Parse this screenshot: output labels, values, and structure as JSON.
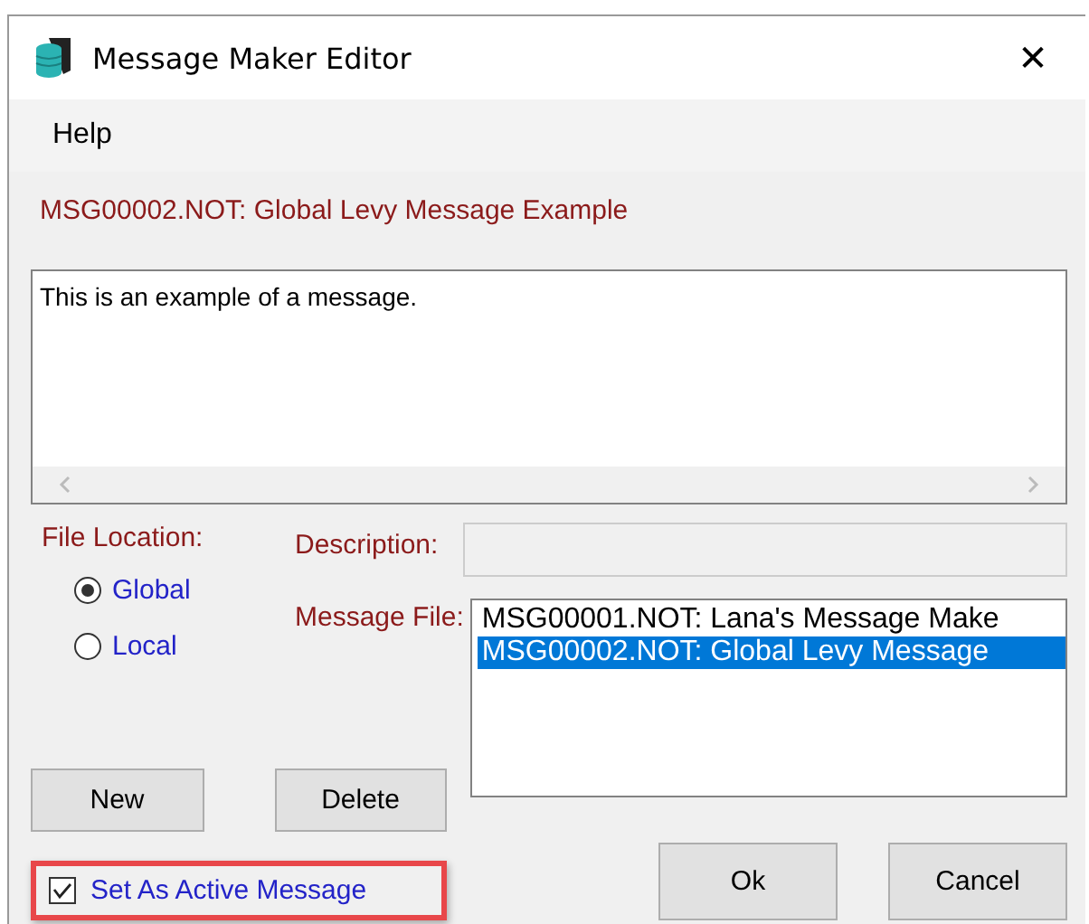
{
  "window": {
    "title": "Message Maker Editor",
    "close": "✕"
  },
  "menu": [
    {
      "label": "Help"
    }
  ],
  "heading": "MSG00002.NOT: Global Levy Message Example",
  "message_text": "This is an example of a message.",
  "file_location": {
    "label": "File Location:",
    "options": [
      {
        "label": "Global",
        "selected": true
      },
      {
        "label": "Local",
        "selected": false
      }
    ]
  },
  "description": {
    "label": "Description:",
    "disabled": true
  },
  "message_file": {
    "label": "Message File:",
    "items": [
      {
        "label": "MSG00001.NOT: Lana's Message Make",
        "selected": false
      },
      {
        "label": "MSG00002.NOT: Global Levy Message",
        "selected": true
      }
    ]
  },
  "buttons_left": [
    "New",
    "Delete"
  ],
  "active_checkbox": {
    "label": "Set As Active Message",
    "checked": true,
    "highlighted": true
  },
  "buttons_right": [
    "Ok",
    "Cancel"
  ]
}
